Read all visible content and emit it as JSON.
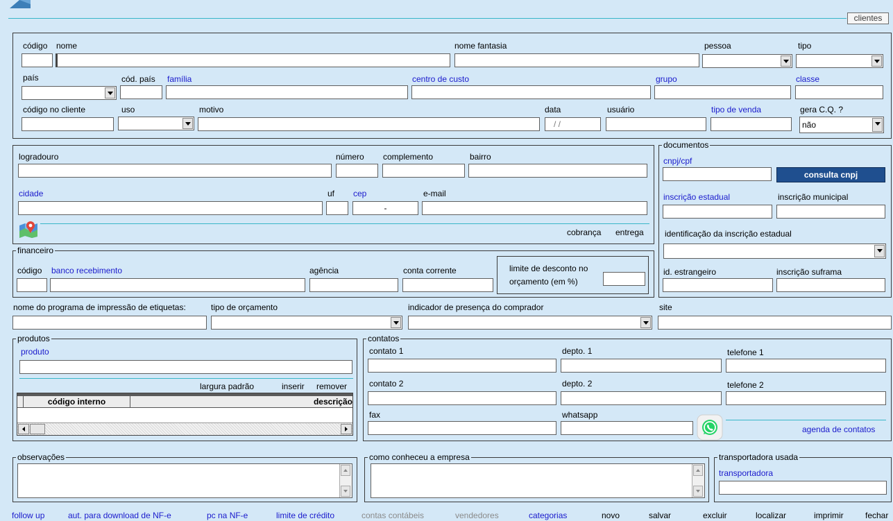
{
  "window": {
    "title": "clientes"
  },
  "ident": {
    "codigo_label": "código",
    "nome_label": "nome",
    "nome_fantasia_label": "nome fantasia",
    "pessoa_label": "pessoa",
    "tipo_label": "tipo",
    "pais_label": "país",
    "cod_pais_label": "cód. país",
    "familia_label": "família",
    "centro_custo_label": "centro de custo",
    "grupo_label": "grupo",
    "classe_label": "classe",
    "codigo_cliente_label": "código no cliente",
    "uso_label": "uso",
    "motivo_label": "motivo",
    "data_label": "data",
    "data_value": " / /",
    "usuario_label": "usuário",
    "tipo_venda_label": "tipo de venda",
    "gera_cq_label": "gera C.Q. ?",
    "gera_cq_value": "não"
  },
  "address": {
    "logradouro_label": "logradouro",
    "numero_label": "número",
    "complemento_label": "complemento",
    "bairro_label": "bairro",
    "cidade_label": "cidade",
    "uf_label": "uf",
    "cep_label": "cep",
    "cep_value": "-",
    "email_label": "e-mail",
    "cobranca_label": "cobrança",
    "entrega_label": "entrega"
  },
  "documentos": {
    "title": "documentos",
    "cnpj_label": "cnpj/cpf",
    "consulta_button": "consulta cnpj",
    "ie_label": "inscrição estadual",
    "im_label": "inscrição municipal",
    "ident_ie_label": "identificação da inscrição estadual",
    "id_estrangeiro_label": "id. estrangeiro",
    "suframa_label": "inscrição suframa"
  },
  "financeiro": {
    "title": "financeiro",
    "codigo_label": "código",
    "banco_label": "banco recebimento",
    "agencia_label": "agência",
    "conta_label": "conta corrente",
    "limite_label_1": "limite de desconto no",
    "limite_label_2": "orçamento  (em %)"
  },
  "misc": {
    "programa_label": "nome do programa de impressão de etiquetas:",
    "tipo_orcamento_label": "tipo de orçamento",
    "indicador_label": "indicador de presença do comprador",
    "site_label": "site"
  },
  "produtos": {
    "title": "produtos",
    "produto_label": "produto",
    "largura_label": "largura padrão",
    "inserir_label": "inserir",
    "remover_label": "remover",
    "columns": [
      "código interno",
      "descrição"
    ]
  },
  "contatos": {
    "title": "contatos",
    "contato1_label": "contato 1",
    "depto1_label": "depto. 1",
    "telefone1_label": "telefone 1",
    "contato2_label": "contato 2",
    "depto2_label": "depto. 2",
    "telefone2_label": "telefone 2",
    "fax_label": "fax",
    "whatsapp_label": "whatsapp",
    "agenda_label": "agenda de contatos"
  },
  "observacoes": {
    "title": "observações"
  },
  "como_conheceu": {
    "title": "como conheceu a empresa"
  },
  "transportadora": {
    "title": "transportadora usada",
    "label": "transportadora"
  },
  "bottom_nav": {
    "items": [
      "follow up",
      "aut. para download de NF-e",
      "pc na NF-e",
      "limite de crédito",
      "contas contábeis",
      "vendedores",
      "categorias",
      "novo",
      "salvar",
      "excluir",
      "localizar",
      "imprimir",
      "fechar"
    ]
  },
  "icons": {
    "map": "map-pin-icon",
    "whatsapp": "whatsapp-icon",
    "app": "app-logo-icon"
  },
  "colors": {
    "background": "#d4e8f7",
    "link": "#1a1acc",
    "accent_line": "#38b6c8",
    "button": "#1f4f8f",
    "whatsapp": "#25d366"
  }
}
